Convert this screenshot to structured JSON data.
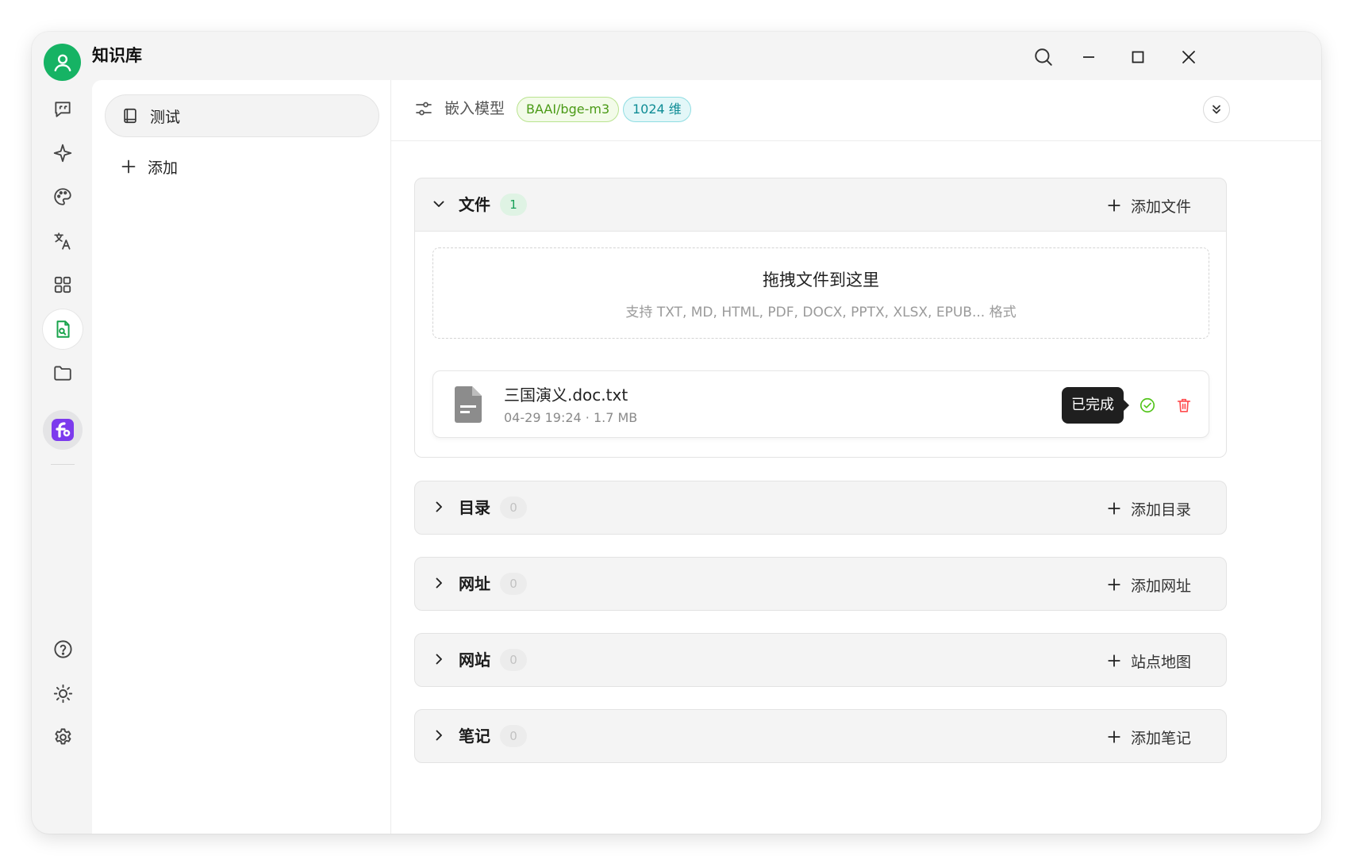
{
  "app": {
    "title": "知识库",
    "avatar_icon": "user-icon",
    "accent": "#16b364"
  },
  "window_controls": [
    "search-icon",
    "minimize-icon",
    "maximize-icon",
    "close-icon"
  ],
  "rail": {
    "items": [
      "chat-icon",
      "sparkle-icon",
      "palette-icon",
      "translate-icon",
      "apps-grid-icon",
      "knowledge-icon",
      "folder-icon",
      "app-logo-icon"
    ],
    "active": "knowledge-icon",
    "bottom": [
      "help-icon",
      "sun-icon",
      "settings-icon"
    ]
  },
  "knowledge_list": {
    "items": [
      {
        "label": "测试",
        "icon": "book-icon"
      }
    ],
    "add_label": "添加"
  },
  "header": {
    "embed_label": "嵌入模型",
    "model_tag": "BAAI/bge-m3",
    "dim_tag": "1024 维"
  },
  "sections": [
    {
      "title": "文件",
      "count": "1",
      "action": "添加文件",
      "expanded": true
    },
    {
      "title": "目录",
      "count": "0",
      "action": "添加目录",
      "expanded": false
    },
    {
      "title": "网址",
      "count": "0",
      "action": "添加网址",
      "expanded": false
    },
    {
      "title": "网站",
      "count": "0",
      "action": "站点地图",
      "expanded": false
    },
    {
      "title": "笔记",
      "count": "0",
      "action": "添加笔记",
      "expanded": false
    }
  ],
  "dropzone": {
    "title": "拖拽文件到这里",
    "hint": "支持 TXT, MD, HTML, PDF, DOCX, PPTX, XLSX, EPUB... 格式"
  },
  "files": [
    {
      "name": "三国演义.doc.txt",
      "meta": "04-29 19:24 · 1.7 MB",
      "status_tooltip": "已完成"
    }
  ],
  "colors": {
    "success": "#52c41a",
    "danger": "#ff4d4f",
    "tag_green": "#4a9a16",
    "tag_cyan": "#0e8c95"
  }
}
